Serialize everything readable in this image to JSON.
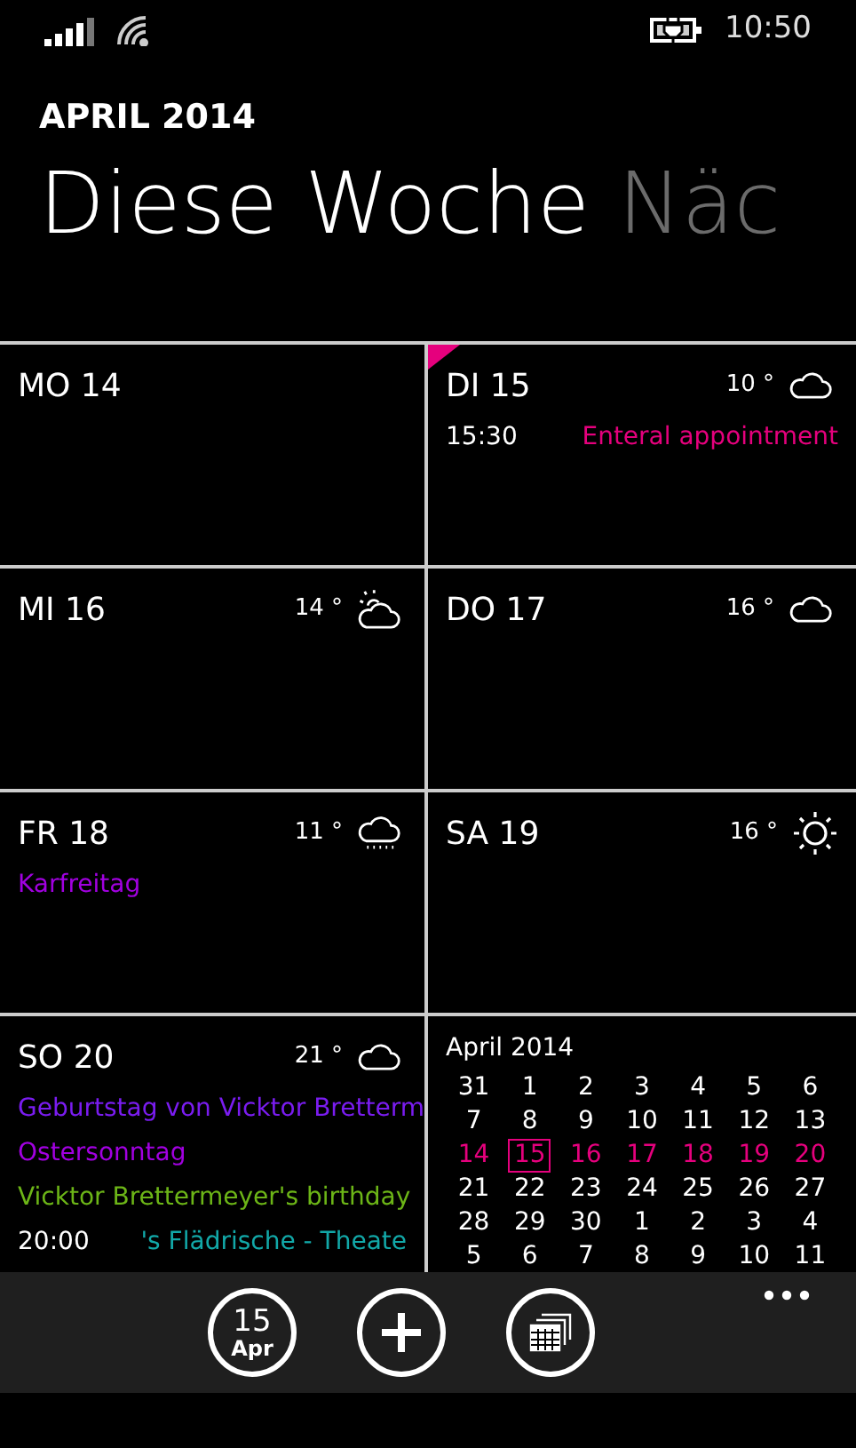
{
  "status_bar": {
    "time": "10:50"
  },
  "header": {
    "subtitle": "APRIL 2014",
    "pivots": [
      {
        "label": "Diese Woche",
        "selected": true
      },
      {
        "label": "Näc",
        "selected": false
      }
    ]
  },
  "days": [
    {
      "label": "MO 14",
      "today": false
    },
    {
      "label": "DI 15",
      "today": true,
      "temperature": "10 °",
      "weather": {
        "kind": "cloud"
      },
      "events": [
        {
          "time": "15:30",
          "title": "Enteral appointment",
          "color": "#e5007d"
        }
      ]
    },
    {
      "label": "MI 16",
      "today": false,
      "temperature": "14 °",
      "weather": {
        "kind": "partly-sunny"
      }
    },
    {
      "label": "DO 17",
      "today": false,
      "temperature": "16 °",
      "weather": {
        "kind": "cloud"
      }
    },
    {
      "label": "FR 18",
      "today": false,
      "temperature": "11 °",
      "weather": {
        "kind": "rain"
      },
      "events": [
        {
          "title": "Karfreitag",
          "color": "#a100e0"
        }
      ]
    },
    {
      "label": "SA 19",
      "today": false,
      "temperature": "16 °",
      "weather": {
        "kind": "sun"
      }
    },
    {
      "label": "SO 20",
      "today": false,
      "temperature": "21 °",
      "weather": {
        "kind": "cloud"
      },
      "events": [
        {
          "title": "Geburtstag von Vicktor Bretterm",
          "color": "#7a1cf0"
        },
        {
          "title": "Ostersonntag",
          "color": "#a100e0"
        },
        {
          "title": "Vicktor Brettermeyer's birthday",
          "color": "#6cb517"
        },
        {
          "time": "20:00",
          "title": "'s Flädrische - Theate",
          "color": "#12a8a8"
        }
      ]
    }
  ],
  "mini_calendar": {
    "title": "April 2014",
    "weeks": [
      {
        "highlighted": false,
        "days": [
          {
            "day": "31",
            "today": false
          },
          {
            "day": "1",
            "today": false
          },
          {
            "day": "2",
            "today": false
          },
          {
            "day": "3",
            "today": false
          },
          {
            "day": "4",
            "today": false
          },
          {
            "day": "5",
            "today": false
          },
          {
            "day": "6",
            "today": false
          }
        ]
      },
      {
        "highlighted": false,
        "days": [
          {
            "day": "7",
            "today": false
          },
          {
            "day": "8",
            "today": false
          },
          {
            "day": "9",
            "today": false
          },
          {
            "day": "10",
            "today": false
          },
          {
            "day": "11",
            "today": false
          },
          {
            "day": "12",
            "today": false
          },
          {
            "day": "13",
            "today": false
          }
        ]
      },
      {
        "highlighted": true,
        "days": [
          {
            "day": "14",
            "today": false
          },
          {
            "day": "15",
            "today": true
          },
          {
            "day": "16",
            "today": false
          },
          {
            "day": "17",
            "today": false
          },
          {
            "day": "18",
            "today": false
          },
          {
            "day": "19",
            "today": false
          },
          {
            "day": "20",
            "today": false
          }
        ]
      },
      {
        "highlighted": false,
        "days": [
          {
            "day": "21",
            "today": false
          },
          {
            "day": "22",
            "today": false
          },
          {
            "day": "23",
            "today": false
          },
          {
            "day": "24",
            "today": false
          },
          {
            "day": "25",
            "today": false
          },
          {
            "day": "26",
            "today": false
          },
          {
            "day": "27",
            "today": false
          }
        ]
      },
      {
        "highlighted": false,
        "days": [
          {
            "day": "28",
            "today": false
          },
          {
            "day": "29",
            "today": false
          },
          {
            "day": "30",
            "today": false
          },
          {
            "day": "1",
            "today": false
          },
          {
            "day": "2",
            "today": false
          },
          {
            "day": "3",
            "today": false
          },
          {
            "day": "4",
            "today": false
          }
        ]
      },
      {
        "highlighted": false,
        "days": [
          {
            "day": "5",
            "today": false
          },
          {
            "day": "6",
            "today": false
          },
          {
            "day": "7",
            "today": false
          },
          {
            "day": "8",
            "today": false
          },
          {
            "day": "9",
            "today": false
          },
          {
            "day": "10",
            "today": false
          },
          {
            "day": "11",
            "today": false
          }
        ]
      }
    ]
  },
  "app_bar": {
    "buttons": [
      {
        "kind": "today",
        "day": "15",
        "month": "Apr"
      },
      {
        "kind": "add"
      },
      {
        "kind": "month"
      }
    ]
  }
}
